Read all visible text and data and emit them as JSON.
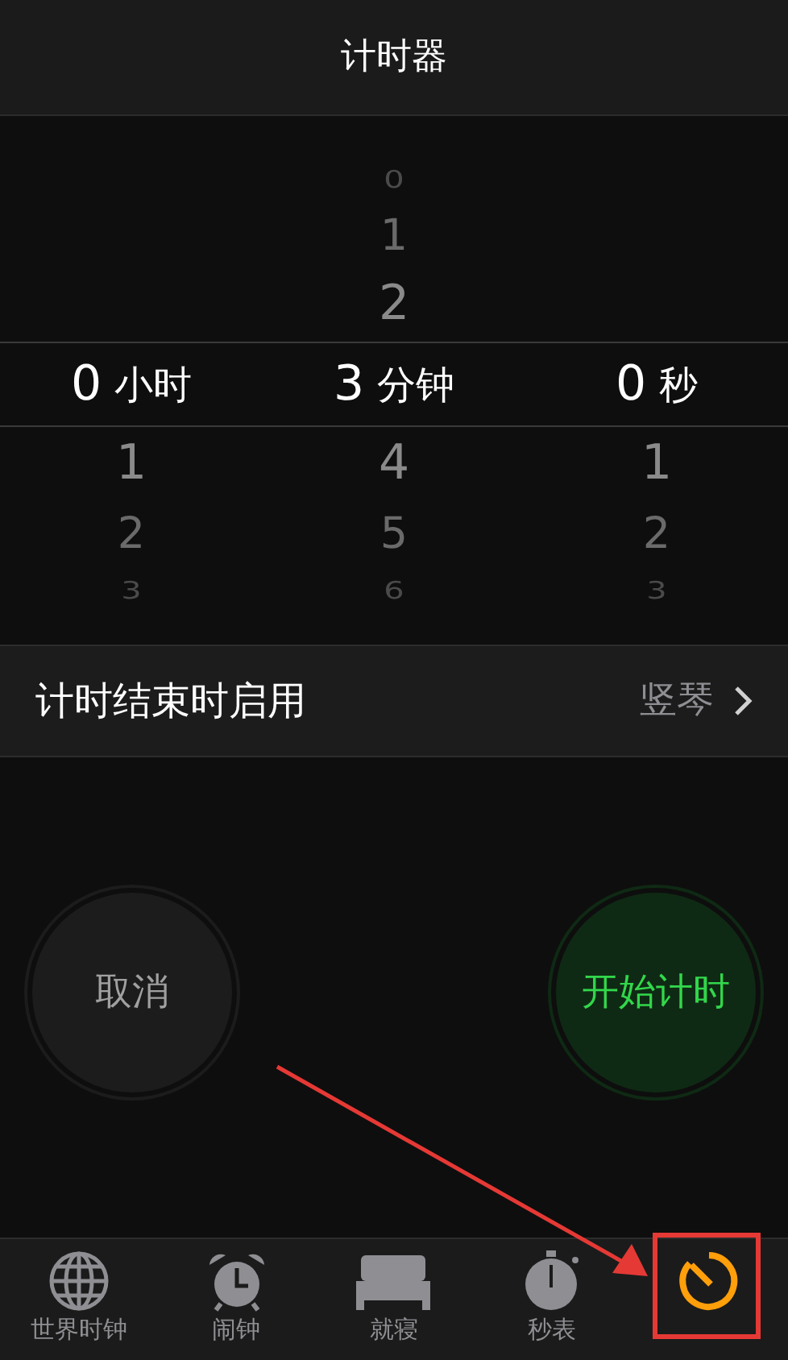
{
  "header": {
    "title": "计时器"
  },
  "picker": {
    "columns": [
      {
        "value": "0",
        "unit": "小时",
        "below": [
          "1",
          "2",
          "3"
        ]
      },
      {
        "above": [
          "0",
          "1",
          "2"
        ],
        "value": "3",
        "unit": "分钟",
        "below": [
          "4",
          "5",
          "6"
        ]
      },
      {
        "value": "0",
        "unit": "秒",
        "below": [
          "1",
          "2",
          "3"
        ]
      }
    ]
  },
  "sound_row": {
    "label": "计时结束时启用",
    "value": "竖琴"
  },
  "buttons": [
    {
      "label": "取消",
      "kind": "cancel"
    },
    {
      "label": "开始计时",
      "kind": "start"
    }
  ],
  "tabs": [
    {
      "label": "世界时钟",
      "kind": "globe",
      "selected": false
    },
    {
      "label": "闹钟",
      "kind": "alarm",
      "selected": false
    },
    {
      "label": "就寝",
      "kind": "bed",
      "selected": false
    },
    {
      "label": "秒表",
      "kind": "stopwatch",
      "selected": false
    },
    {
      "kind": "timer",
      "selected": true
    }
  ]
}
